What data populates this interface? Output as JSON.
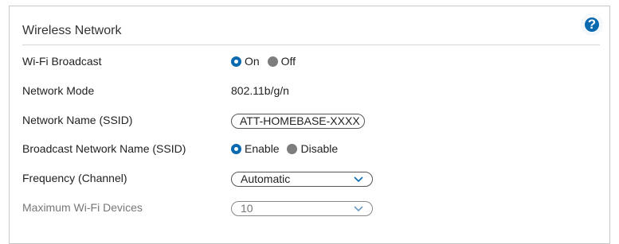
{
  "section": {
    "title": "Wireless Network",
    "help_icon": "help-icon",
    "accent": "#0a6ab0"
  },
  "rows": {
    "wifi_broadcast": {
      "label": "Wi-Fi Broadcast",
      "on": "On",
      "off": "Off",
      "selected": "On"
    },
    "network_mode": {
      "label": "Network Mode",
      "value": "802.11b/g/n"
    },
    "ssid": {
      "label": "Network Name (SSID)",
      "value": "ATT-HOMEBASE-XXXX"
    },
    "broadcast_ssid": {
      "label": "Broadcast Network Name (SSID)",
      "enable": "Enable",
      "disable": "Disable",
      "selected": "Enable"
    },
    "frequency": {
      "label": "Frequency (Channel)",
      "value": "Automatic"
    },
    "max_devices": {
      "label": "Maximum Wi-Fi Devices",
      "value": "10"
    }
  }
}
